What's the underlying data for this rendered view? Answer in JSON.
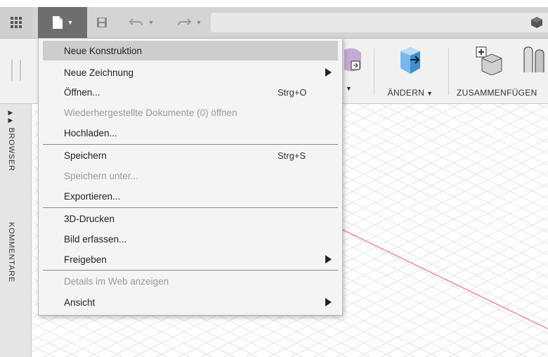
{
  "menu": {
    "items": [
      {
        "label": "Neue Konstruktion",
        "shortcut": "",
        "disabled": false,
        "highlighted": true,
        "submenu": false
      },
      {
        "label": "Neue Zeichnung",
        "shortcut": "",
        "disabled": false,
        "highlighted": false,
        "submenu": true
      },
      {
        "label": "Öffnen...",
        "shortcut": "Strg+O",
        "disabled": false,
        "highlighted": false,
        "submenu": false
      },
      {
        "label": "Wiederhergestellte Dokumente (0) öffnen",
        "shortcut": "",
        "disabled": true,
        "highlighted": false,
        "submenu": false
      },
      {
        "label": "Hochladen...",
        "shortcut": "",
        "disabled": false,
        "highlighted": false,
        "submenu": false
      },
      {
        "label": "Speichern",
        "shortcut": "Strg+S",
        "disabled": false,
        "highlighted": false,
        "submenu": false
      },
      {
        "label": "Speichern unter...",
        "shortcut": "",
        "disabled": true,
        "highlighted": false,
        "submenu": false
      },
      {
        "label": "Exportieren...",
        "shortcut": "",
        "disabled": false,
        "highlighted": false,
        "submenu": false
      },
      {
        "label": "3D-Drucken",
        "shortcut": "",
        "disabled": false,
        "highlighted": false,
        "submenu": false
      },
      {
        "label": "Bild erfassen...",
        "shortcut": "",
        "disabled": false,
        "highlighted": false,
        "submenu": false
      },
      {
        "label": "Freigeben",
        "shortcut": "",
        "disabled": false,
        "highlighted": false,
        "submenu": true
      },
      {
        "label": "Details im Web anzeigen",
        "shortcut": "",
        "disabled": true,
        "highlighted": false,
        "submenu": false
      },
      {
        "label": "Ansicht",
        "shortcut": "",
        "disabled": false,
        "highlighted": false,
        "submenu": true
      }
    ]
  },
  "ribbon": {
    "aendern_label": "ÄNDERN",
    "zusammenfuegen_label": "ZUSAMMENFÜGEN"
  },
  "panel": {
    "browser_label": "BROWSER",
    "kommentare_label": "KOMMENTARE"
  },
  "icons": {
    "apps": "grid-icon",
    "file": "file-icon",
    "save": "save-icon",
    "undo": "undo-icon",
    "redo": "redo-icon",
    "data_panel": "cube-icon"
  },
  "colors": {
    "menu_highlight": "#cdcdcd",
    "disabled_text": "#9a9a9a",
    "axis_line": "#f08c9a",
    "accent_blue": "#3d8fd1"
  }
}
